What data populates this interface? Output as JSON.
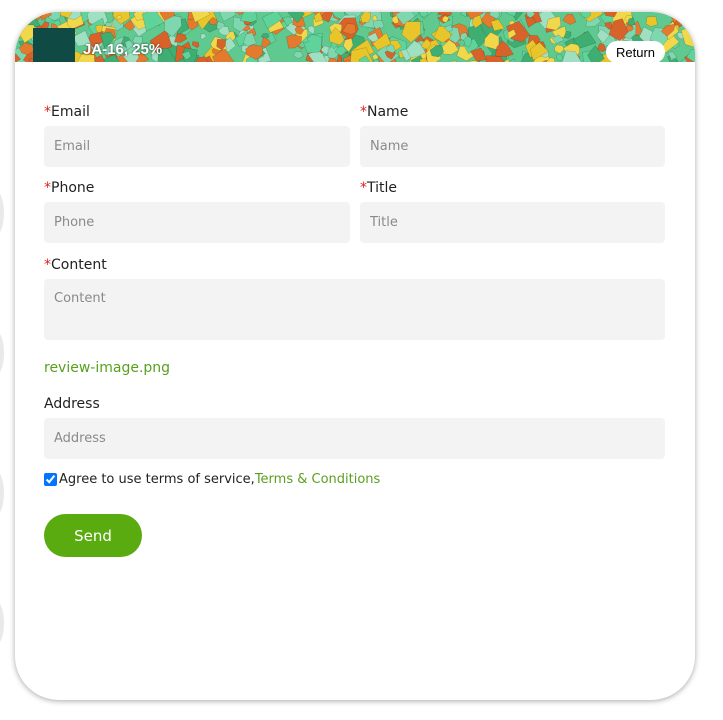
{
  "banner": {
    "title": "JA-16, 25%",
    "return_label": "Return"
  },
  "form": {
    "email": {
      "label": "Email",
      "placeholder": "Email",
      "required_mark": "*"
    },
    "name": {
      "label": "Name",
      "placeholder": "Name",
      "required_mark": "*"
    },
    "phone": {
      "label": "Phone",
      "placeholder": "Phone",
      "required_mark": "*"
    },
    "title": {
      "label": "Title",
      "placeholder": "Title",
      "required_mark": "*"
    },
    "content": {
      "label": "Content",
      "placeholder": "Content",
      "required_mark": "*"
    },
    "file_name": "review-image.png",
    "address": {
      "label": "Address",
      "placeholder": "Address"
    },
    "agree_text": "Agree to use terms of service,",
    "terms_link": "Terms & Conditions",
    "agree_checked": true,
    "send_label": "Send"
  },
  "colors": {
    "accent": "#5aab0f",
    "link": "#5aa01e",
    "required": "#e02020",
    "input_bg": "#f3f3f3"
  }
}
